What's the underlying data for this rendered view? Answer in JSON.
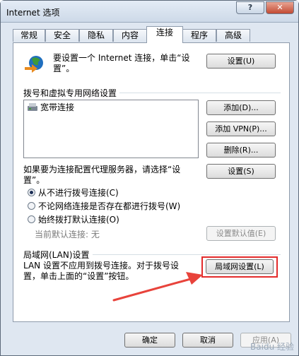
{
  "window": {
    "title": "Internet 选项",
    "help_button": "?",
    "close_button": "✕"
  },
  "tabs": [
    {
      "label": "常规"
    },
    {
      "label": "安全"
    },
    {
      "label": "隐私"
    },
    {
      "label": "内容"
    },
    {
      "label": "连接"
    },
    {
      "label": "程序"
    },
    {
      "label": "高级"
    }
  ],
  "active_tab": "连接",
  "setup": {
    "text_line1": "要设置一个 Internet 连接，单击“设",
    "text_line2": "置”。",
    "button": "设置(U)"
  },
  "dialup": {
    "section_label": "拨号和虚拟专用网络设置",
    "connections": [
      "宽带连接"
    ],
    "add_button": "添加(D)...",
    "add_vpn_button": "添加 VPN(P)...",
    "delete_button": "删除(R)...",
    "proxy_text_line1": "如果要为连接配置代理服务器，请选择“设",
    "proxy_text_line2": "置”。",
    "settings_button": "设置(S)",
    "options": [
      {
        "label": "从不进行拨号连接(C)",
        "checked": true
      },
      {
        "label": "不论网络连接是否存在都进行拨号(W)",
        "checked": false
      },
      {
        "label": "始终拨打默认连接(O)",
        "checked": false
      }
    ],
    "current_default_label": "当前默认连接:",
    "current_default_value": "无",
    "set_default_button": "设置默认值(E)"
  },
  "lan": {
    "section_label": "局域网(LAN)设置",
    "text_line1": "LAN 设置不应用到拨号连接。对于拨号设",
    "text_line2": "置，单击上面的“设置”按钮。",
    "button": "局域网设置(L)"
  },
  "footer": {
    "ok_button": "确定",
    "cancel_button": "取消",
    "apply_button": "应用(A)"
  },
  "watermark": "Baidu 经验",
  "colors": {
    "highlight_box": "#e32b2b",
    "arrow": "#e8433b",
    "icon_blue": "#1f6fbf",
    "icon_green": "#3e9a3a",
    "icon_orange": "#e98b1f"
  }
}
